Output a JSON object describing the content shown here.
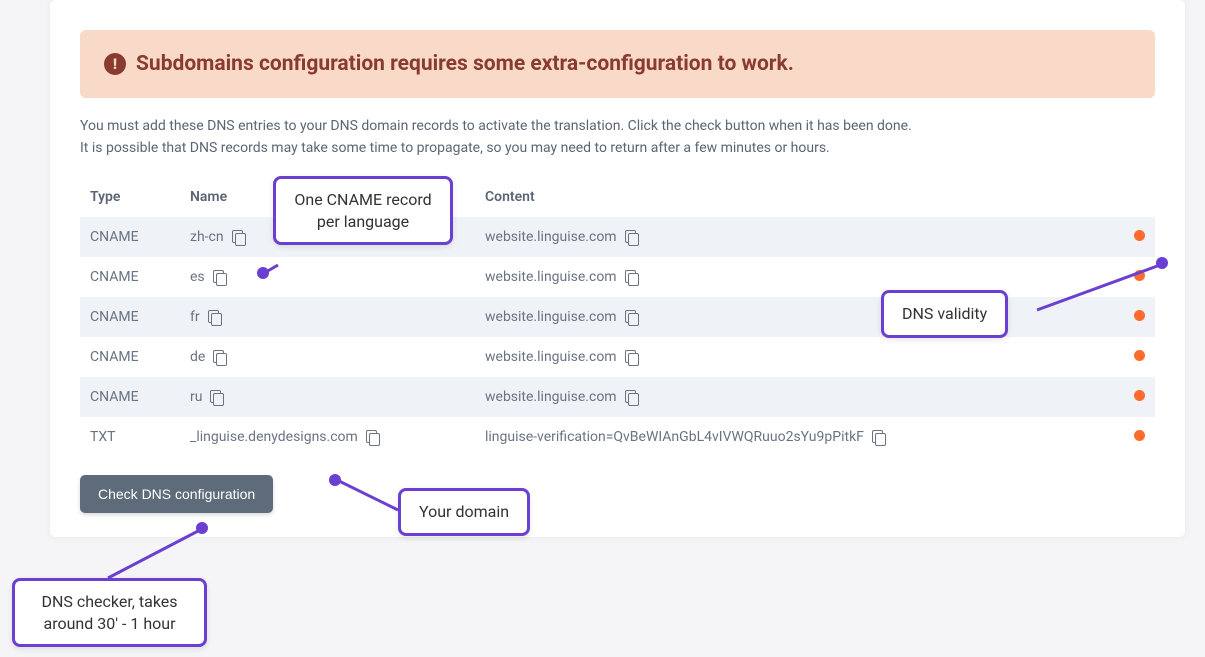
{
  "alert": {
    "text": "Subdomains configuration requires some extra-configuration to work."
  },
  "instructions": {
    "line1": "You must add these DNS entries to your DNS domain records to activate the translation. Click the check button when it has been done.",
    "line2": "It is possible that DNS records may take some time to propagate, so you may need to return after a few minutes or hours."
  },
  "table": {
    "headers": {
      "type": "Type",
      "name": "Name",
      "content": "Content"
    },
    "rows": [
      {
        "type": "CNAME",
        "name": "zh-cn",
        "content": "website.linguise.com",
        "status": "invalid"
      },
      {
        "type": "CNAME",
        "name": "es",
        "content": "website.linguise.com",
        "status": "invalid"
      },
      {
        "type": "CNAME",
        "name": "fr",
        "content": "website.linguise.com",
        "status": "invalid"
      },
      {
        "type": "CNAME",
        "name": "de",
        "content": "website.linguise.com",
        "status": "invalid"
      },
      {
        "type": "CNAME",
        "name": "ru",
        "content": "website.linguise.com",
        "status": "invalid"
      },
      {
        "type": "TXT",
        "name": "_linguise.denydesigns.com",
        "content": "linguise-verification=QvBeWIAnGbL4vIVWQRuuo2sYu9pPitkF",
        "status": "invalid"
      }
    ]
  },
  "button": {
    "check_label": "Check DNS configuration"
  },
  "callouts": {
    "cname": "One CNAME record per language",
    "validity": "DNS validity",
    "domain": "Your domain",
    "checker": "DNS checker, takes around 30' - 1 hour"
  },
  "colors": {
    "accent_purple": "#6b3fd1",
    "status_orange": "#ff6b2d",
    "alert_bg": "#f9d9c7",
    "alert_text": "#8a3b2f"
  }
}
